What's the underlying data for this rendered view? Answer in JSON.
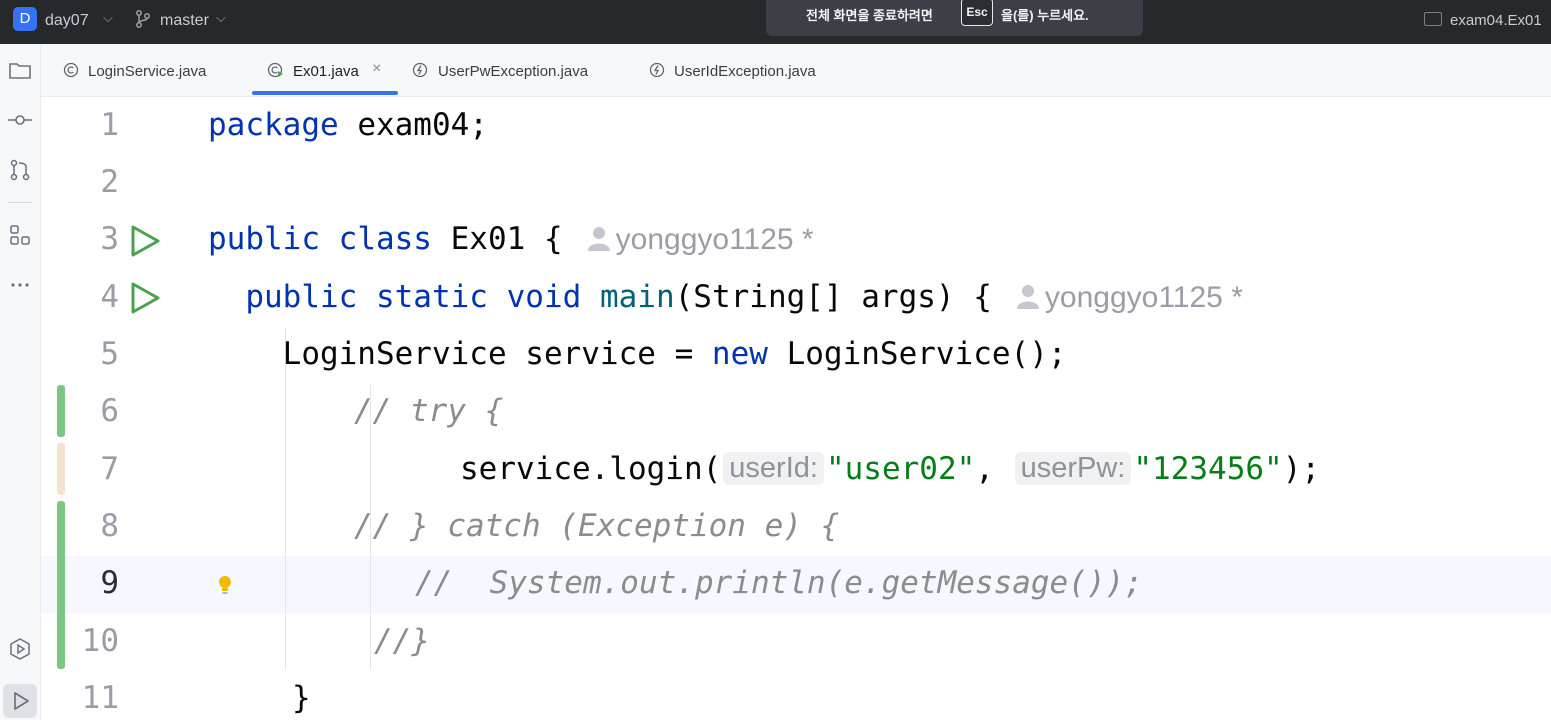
{
  "titlebar": {
    "project_badge": "D",
    "project_name": "day07",
    "branch": "master",
    "fullscreen_tip_pre": "전체 화면을 종료하려면",
    "fullscreen_tip_key": "Esc",
    "fullscreen_tip_post": "을(를) 누르세요.",
    "run_config": "exam04.Ex01"
  },
  "tabs": [
    {
      "label": "LoginService.java",
      "icon": "class-icon"
    },
    {
      "label": "Ex01.java",
      "icon": "runnable-class-icon",
      "active": true,
      "close": "×"
    },
    {
      "label": "UserPwException.java",
      "icon": "exception-class-icon"
    },
    {
      "label": "UserIdException.java",
      "icon": "exception-class-icon"
    }
  ],
  "editor": {
    "line_numbers": [
      "1",
      "2",
      "3",
      "4",
      "5",
      "6",
      "7",
      "8",
      "9",
      "10",
      "11"
    ],
    "current_line": "9",
    "code": {
      "l1_kw": "package",
      "l1_rest": " exam04;",
      "l3_kw1": "public",
      "l3_kw2": "class",
      "l3_rest": " Ex01 {",
      "l4_kw1": "public",
      "l4_kw2": "static",
      "l4_kw3": "void",
      "l4_fn": "main",
      "l4_rest": "(String[] args) {",
      "l5_a": "LoginService service = ",
      "l5_kw": "new",
      "l5_b": " LoginService();",
      "l6_cmt": "// try {",
      "l7_a": "service.login(",
      "l7_hint1": "userId:",
      "l7_str1": "\"user02\"",
      "l7_comma": ", ",
      "l7_hint2": "userPw:",
      "l7_str2": "\"123456\"",
      "l7_end": ");",
      "l8_cmt": "// } catch (Exception e) {",
      "l9_cmt": "//  System.out.println(e.getMessage());",
      "l10_cmt": "//}",
      "l11": "}"
    },
    "author_hint": "yonggyo1125 *"
  },
  "colors": {
    "keyword": "#0033b3",
    "string": "#067d17",
    "comment": "#8c8c8c",
    "accent": "#3574f0",
    "vcs_added": "#7ec482",
    "vcs_modified": "#f3e4d2"
  }
}
